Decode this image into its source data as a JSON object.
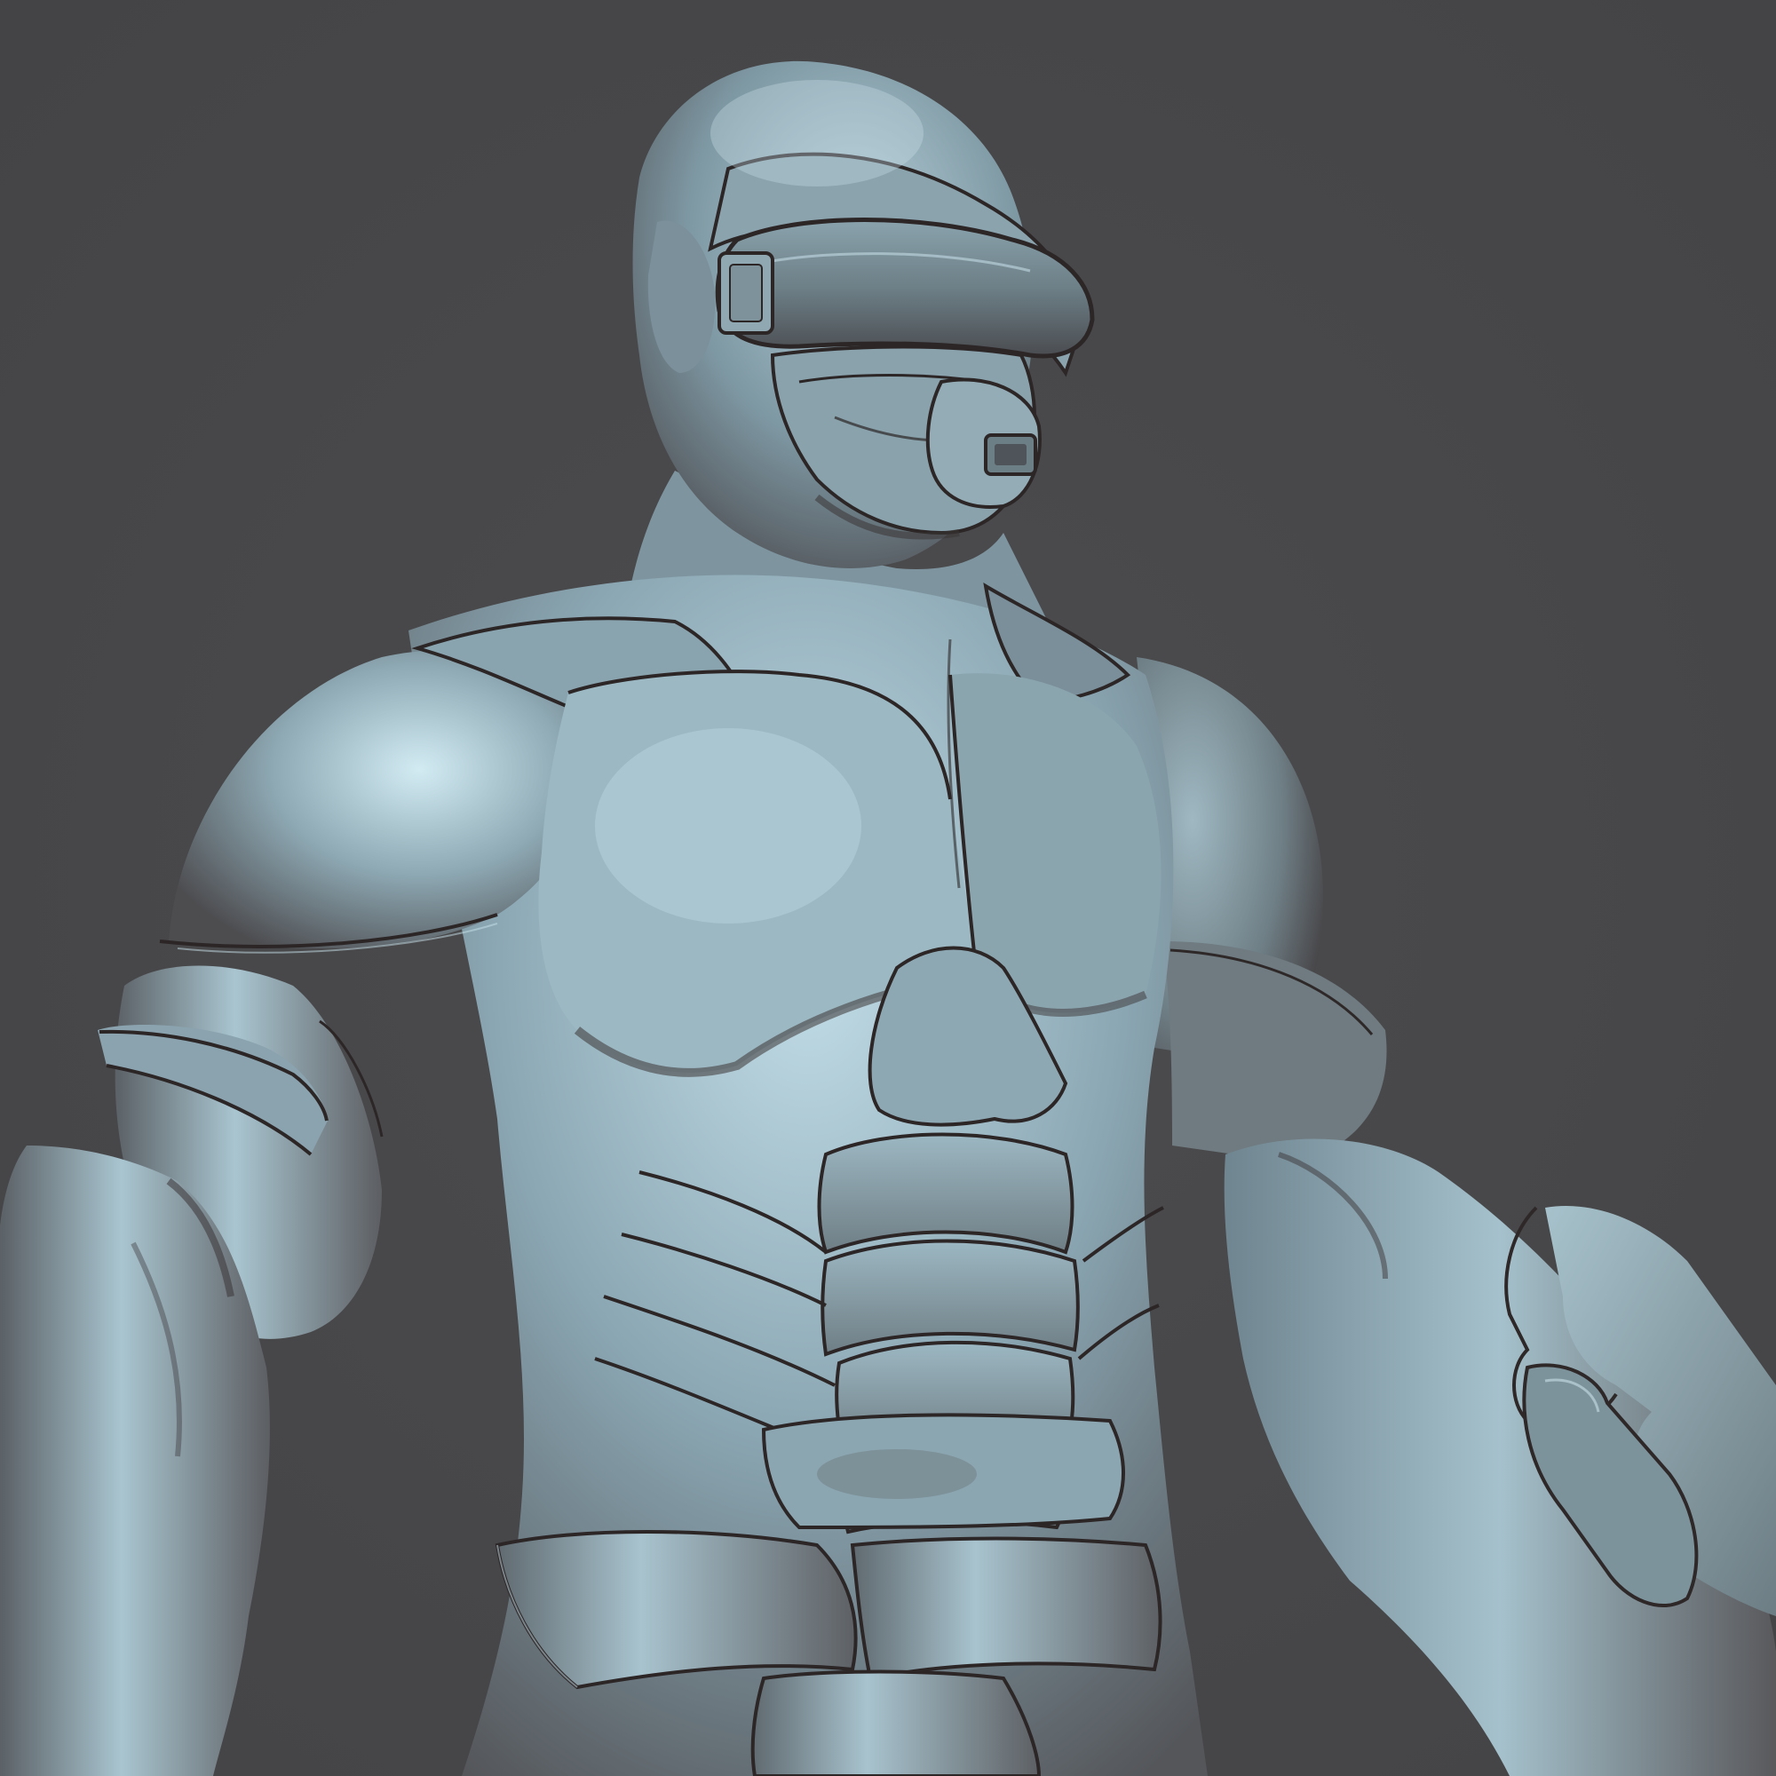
{
  "scene": {
    "subject": "sculpted-armored-figure",
    "background_color": "#48484a",
    "material": {
      "base": "#7d9aa6",
      "light": "#b9d6e2",
      "highlight": "#d8ecf2",
      "shadow": "#4a4a4c",
      "deep_shadow": "#3a3434",
      "seam": "#2a2426"
    }
  }
}
